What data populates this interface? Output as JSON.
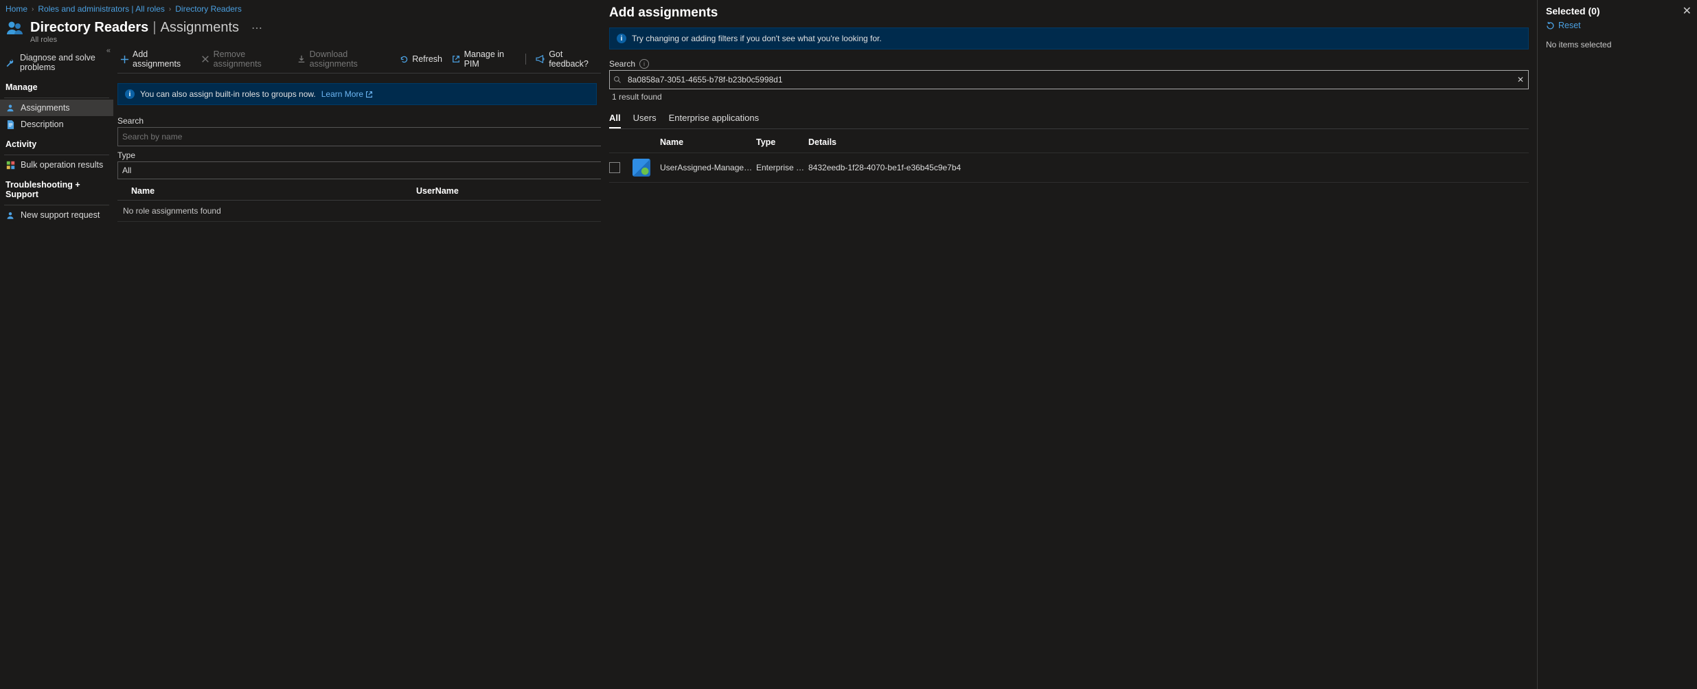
{
  "breadcrumb": [
    "Home",
    "Roles and administrators | All roles",
    "Directory Readers"
  ],
  "page": {
    "role_name": "Directory Readers",
    "section": "Assignments",
    "subtitle": "All roles"
  },
  "sidenav": {
    "diagnose": "Diagnose and solve problems",
    "manage_hdr": "Manage",
    "assignments": "Assignments",
    "description": "Description",
    "activity_hdr": "Activity",
    "bulk": "Bulk operation results",
    "ts_hdr": "Troubleshooting + Support",
    "support": "New support request"
  },
  "toolbar": {
    "add": "Add assignments",
    "remove": "Remove assignments",
    "download": "Download assignments",
    "refresh": "Refresh",
    "pim": "Manage in PIM",
    "feedback": "Got feedback?"
  },
  "banner": {
    "text": "You can also assign built-in roles to groups now.",
    "link": "Learn More"
  },
  "filters": {
    "search_label": "Search",
    "search_placeholder": "Search by name",
    "type_label": "Type",
    "type_value": "All"
  },
  "table": {
    "col_name": "Name",
    "col_user": "UserName",
    "empty": "No role assignments found"
  },
  "blade": {
    "title": "Add assignments",
    "tip": "Try changing or adding filters if you don't see what you're looking for.",
    "search_label": "Search",
    "search_value": "8a0858a7-3051-4655-b78f-b23b0c5998d1",
    "result_count": "1 result found",
    "tabs": {
      "all": "All",
      "users": "Users",
      "ent": "Enterprise applications"
    },
    "cols": {
      "name": "Name",
      "type": "Type",
      "details": "Details"
    },
    "row": {
      "name": "UserAssigned-ManagedIdentity",
      "type": "Enterprise ap…",
      "details": "8432eedb-1f28-4070-be1f-e36b45c9e7b4"
    }
  },
  "selected": {
    "title": "Selected (0)",
    "reset": "Reset",
    "empty": "No items selected"
  }
}
